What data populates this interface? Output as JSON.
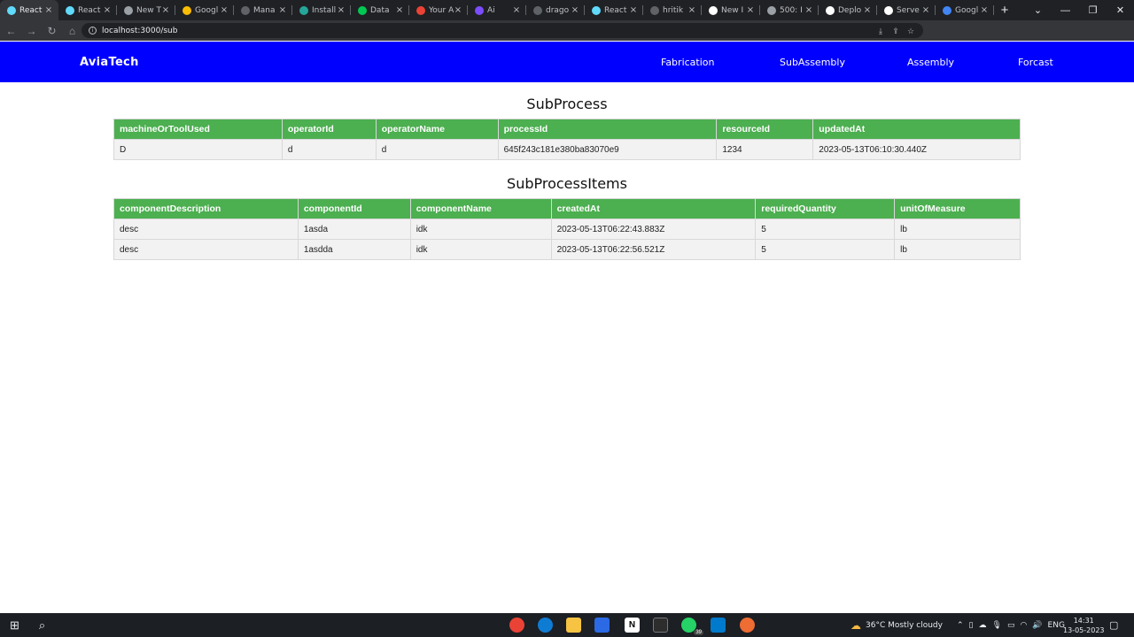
{
  "browser": {
    "tabs": [
      {
        "title": "React",
        "color": "#61dafb",
        "active": true
      },
      {
        "title": "React",
        "color": "#61dafb"
      },
      {
        "title": "New T",
        "color": "#9aa0a6"
      },
      {
        "title": "Googl",
        "color": "#fbbc04"
      },
      {
        "title": "Mana",
        "color": "#5f6368"
      },
      {
        "title": "Install",
        "color": "#26a69a"
      },
      {
        "title": "Data",
        "color": "#00c853"
      },
      {
        "title": "Your A",
        "color": "#ea4335"
      },
      {
        "title": "Ai",
        "color": "#7c4dff"
      },
      {
        "title": "drago",
        "color": "#5f6368"
      },
      {
        "title": "React",
        "color": "#61dafb"
      },
      {
        "title": "hritik",
        "color": "#5f6368"
      },
      {
        "title": "New I",
        "color": "#ffffff"
      },
      {
        "title": "500: I",
        "color": "#9aa0a6"
      },
      {
        "title": "Deplo",
        "color": "#ffffff"
      },
      {
        "title": "Serve",
        "color": "#ffffff"
      },
      {
        "title": "Googl",
        "color": "#4285f4"
      }
    ],
    "url": "localhost:3000/sub"
  },
  "app": {
    "brand": "AviaTech",
    "nav": [
      "Fabrication",
      "SubAssembly",
      "Assembly",
      "Forcast"
    ],
    "primary_color": "#0000ff",
    "header_color": "#4caf50"
  },
  "subprocess": {
    "title": "SubProcess",
    "columns": [
      "machineOrToolUsed",
      "operatorId",
      "operatorName",
      "processId",
      "resourceId",
      "updatedAt"
    ],
    "rows": [
      [
        "D",
        "d",
        "d",
        "645f243c181e380ba83070e9",
        "1234",
        "2023-05-13T06:10:30.440Z"
      ]
    ]
  },
  "subprocess_items": {
    "title": "SubProcessItems",
    "columns": [
      "componentDescription",
      "componentId",
      "componentName",
      "createdAt",
      "requiredQuantity",
      "unitOfMeasure"
    ],
    "rows": [
      [
        "desc",
        "1asda",
        "idk",
        "2023-05-13T06:22:43.883Z",
        "5",
        "lb"
      ],
      [
        "desc",
        "1asdda",
        "idk",
        "2023-05-13T06:22:56.521Z",
        "5",
        "lb"
      ]
    ]
  },
  "taskbar": {
    "weather": "36°C  Mostly cloudy",
    "lang": "ENG",
    "time": "14:31",
    "date": "13-05-2023",
    "whatsapp_badge": "39"
  }
}
